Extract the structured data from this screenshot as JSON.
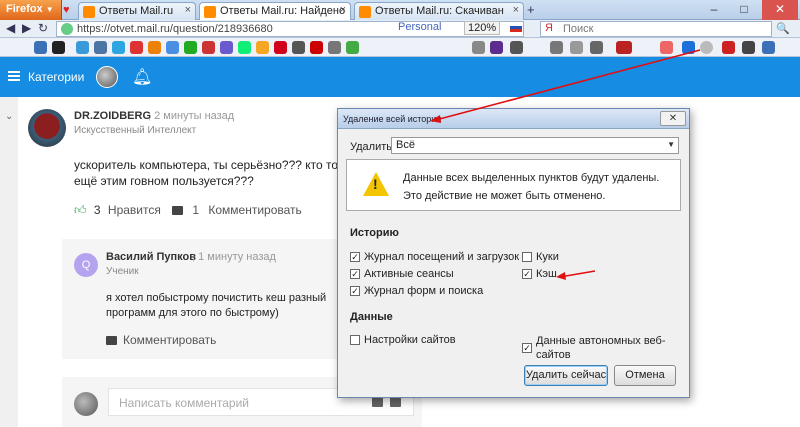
{
  "browser": {
    "menu_label": "Firefox",
    "tabs": [
      {
        "label": "Ответы Mail.ru"
      },
      {
        "label": "Ответы Mail.ru: Найдено"
      },
      {
        "label": "Ответы Mail.ru: Скачиван"
      }
    ],
    "url": "https://otvet.mail.ru/question/218936680",
    "personal": "Personal",
    "zoom": "120%",
    "search_placeholder": "Поиск"
  },
  "site": {
    "categories_label": "Категории"
  },
  "answer": {
    "author": "DR.ZOIDBERG",
    "time": ", 2 минуты назад",
    "subtitle": "Искусственный Интеллект",
    "text": "ускоритель компьютера, ты серьёзно??? кто то ещё этим говном пользуется???",
    "like_count": "3",
    "like_label": "Нравится",
    "comment_count": "1",
    "comment_label": "Комментировать"
  },
  "comment": {
    "avatar_letter": "Q",
    "author": "Василий Пупков",
    "time": ", 1 минуту назад",
    "subtitle": "Ученик",
    "text": "я хотел побыстрому почистить кеш разный программ для этого по быстрому)",
    "action": "Комментировать"
  },
  "write": {
    "placeholder": "Написать комментарий"
  },
  "dialog": {
    "title": "Удаление всей истории",
    "delete_label": "Удалить:",
    "range_value": "Всё",
    "warning_line1": "Данные всех выделенных пунктов будут удалены.",
    "warning_line2": "Это действие не может быть отменено.",
    "history_heading": "Историю",
    "data_heading": "Данные",
    "checkbox_visits": "Журнал посещений и загрузок",
    "checkbox_sessions": "Активные сеансы",
    "checkbox_forms": "Журнал форм и поиска",
    "checkbox_cookies": "Куки",
    "checkbox_cache": "Кэш",
    "checkbox_site_settings": "Настройки сайтов",
    "checkbox_offline_line1": "Данные автономных веб-",
    "checkbox_offline_line2": "сайтов",
    "btn_clear": "Удалить сейчас",
    "btn_cancel": "Отмена",
    "checked_visits": true,
    "checked_sessions": true,
    "checked_forms": true,
    "checked_cookies": false,
    "checked_cache": true,
    "checked_site_settings": false,
    "checked_offline": true
  },
  "colors": {
    "site_header": "#168de2",
    "annotation_arrow": "#e01010",
    "like_green": "#3aa655"
  }
}
